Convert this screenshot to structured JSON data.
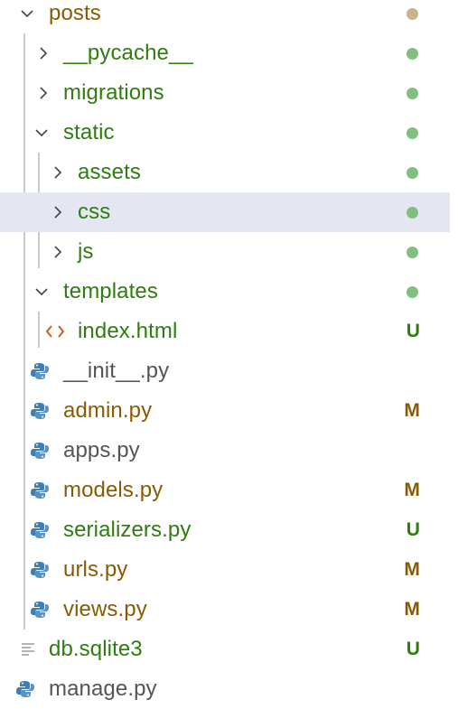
{
  "colors": {
    "untracked": "#2e7d0f",
    "modified": "#8a5a00",
    "plain": "#555555",
    "dot_green": "#7fbf7f",
    "dot_tan": "#c9b48a",
    "selection": "#e4e6f1",
    "html_icon": "#d35a1e",
    "python_blue": "#3f7fb3",
    "python_yellow": "#e7c33f"
  },
  "tree": [
    {
      "label": "posts",
      "kind": "folder",
      "expanded": true,
      "status": "dot",
      "color": "modified"
    },
    {
      "label": "__pycache__",
      "kind": "folder",
      "expanded": false,
      "status": "dot",
      "color": "untracked"
    },
    {
      "label": "migrations",
      "kind": "folder",
      "expanded": false,
      "status": "dot",
      "color": "untracked"
    },
    {
      "label": "static",
      "kind": "folder",
      "expanded": true,
      "status": "dot",
      "color": "untracked"
    },
    {
      "label": "assets",
      "kind": "folder",
      "expanded": false,
      "status": "dot",
      "color": "untracked"
    },
    {
      "label": "css",
      "kind": "folder",
      "expanded": false,
      "status": "dot",
      "color": "untracked",
      "selected": true
    },
    {
      "label": "js",
      "kind": "folder",
      "expanded": false,
      "status": "dot",
      "color": "untracked"
    },
    {
      "label": "templates",
      "kind": "folder",
      "expanded": true,
      "status": "dot",
      "color": "untracked"
    },
    {
      "label": "index.html",
      "kind": "html-file",
      "status": "U",
      "color": "untracked"
    },
    {
      "label": "__init__.py",
      "kind": "python-file",
      "status": "",
      "color": "plain"
    },
    {
      "label": "admin.py",
      "kind": "python-file",
      "status": "M",
      "color": "modified"
    },
    {
      "label": "apps.py",
      "kind": "python-file",
      "status": "",
      "color": "plain"
    },
    {
      "label": "models.py",
      "kind": "python-file",
      "status": "M",
      "color": "modified"
    },
    {
      "label": "serializers.py",
      "kind": "python-file",
      "status": "U",
      "color": "untracked"
    },
    {
      "label": "urls.py",
      "kind": "python-file",
      "status": "M",
      "color": "modified"
    },
    {
      "label": "views.py",
      "kind": "python-file",
      "status": "M",
      "color": "modified"
    },
    {
      "label": "db.sqlite3",
      "kind": "text-file",
      "status": "U",
      "color": "untracked"
    },
    {
      "label": "manage.py",
      "kind": "python-file",
      "status": "",
      "color": "plain"
    }
  ]
}
